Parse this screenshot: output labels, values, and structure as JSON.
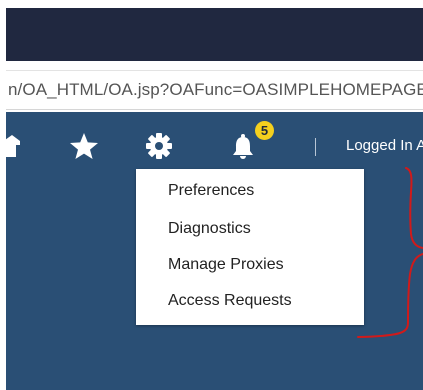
{
  "browser": {
    "url": "n/OA_HTML/OA.jsp?OAFunc=OASIMPLEHOMEPAGE"
  },
  "header": {
    "icons": [
      "home-icon",
      "star-icon",
      "gear-icon",
      "bell-icon"
    ],
    "notification_count": "5",
    "logged_in_text": "Logged In As"
  },
  "settings_menu": {
    "items": [
      {
        "label": "Preferences"
      },
      {
        "label": "Diagnostics"
      },
      {
        "label": "Manage Proxies"
      },
      {
        "label": "Access Requests"
      }
    ]
  },
  "colors": {
    "title_bar": "#202840",
    "app_background": "#2a4f75",
    "badge": "#f4d01e",
    "annotation": "#d11a1a"
  }
}
